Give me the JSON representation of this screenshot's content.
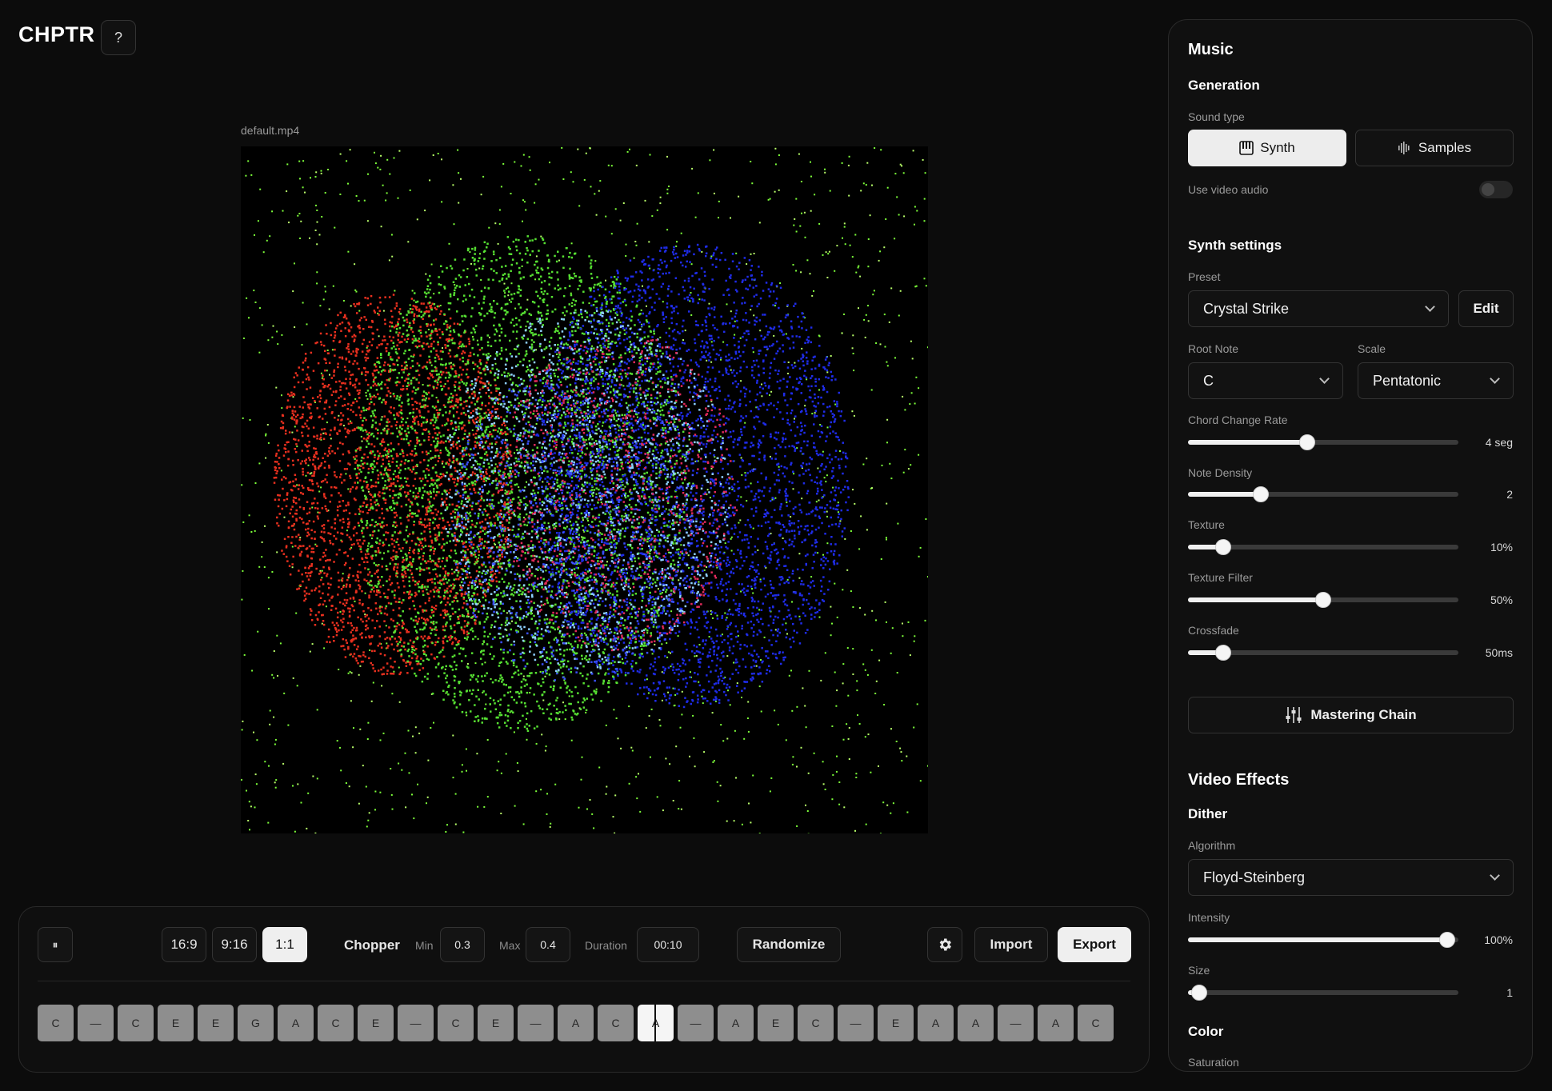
{
  "app": {
    "logo": "CHPTR",
    "help_label": "?"
  },
  "video": {
    "file_name": "default.mp4"
  },
  "transport": {
    "play_pause_label": "⏸",
    "aspect_ratios": [
      {
        "label": "16:9",
        "active": false
      },
      {
        "label": "9:16",
        "active": false
      },
      {
        "label": "1:1",
        "active": true
      }
    ],
    "chopper_label": "Chopper",
    "min_label": "Min",
    "min_value": "0.3",
    "max_label": "Max",
    "max_value": "0.4",
    "duration_label": "Duration",
    "duration_value": "00:10",
    "randomize_label": "Randomize",
    "settings_icon": "gear-icon",
    "import_label": "Import",
    "export_label": "Export",
    "notes": [
      "C",
      "—",
      "C",
      "E",
      "E",
      "G",
      "A",
      "C",
      "E",
      "—",
      "C",
      "E",
      "—",
      "A",
      "C",
      "A",
      "—",
      "A",
      "E",
      "C",
      "—",
      "E",
      "A",
      "A",
      "—",
      "A",
      "C"
    ],
    "active_note_index": 15
  },
  "panel": {
    "music_title": "Music",
    "generation_title": "Generation",
    "sound_type_label": "Sound type",
    "synth_label": "Synth",
    "samples_label": "Samples",
    "use_video_audio_label": "Use video audio",
    "use_video_audio_on": false,
    "synth_settings_title": "Synth settings",
    "preset_label": "Preset",
    "preset_value": "Crystal Strike",
    "edit_label": "Edit",
    "root_note_label": "Root Note",
    "root_note_value": "C",
    "scale_label": "Scale",
    "scale_value": "Pentatonic",
    "sliders": {
      "chord_change_rate": {
        "label": "Chord Change Rate",
        "value_text": "4 seg",
        "fraction": 0.44
      },
      "note_density": {
        "label": "Note Density",
        "value_text": "2",
        "fraction": 0.27
      },
      "texture": {
        "label": "Texture",
        "value_text": "10%",
        "fraction": 0.13
      },
      "texture_filter": {
        "label": "Texture Filter",
        "value_text": "50%",
        "fraction": 0.5
      },
      "crossfade": {
        "label": "Crossfade",
        "value_text": "50ms",
        "fraction": 0.13
      },
      "intensity": {
        "label": "Intensity",
        "value_text": "100%",
        "fraction": 0.96
      },
      "size": {
        "label": "Size",
        "value_text": "1",
        "fraction": 0.04
      }
    },
    "mastering_chain_label": "Mastering Chain",
    "video_effects_title": "Video Effects",
    "dither_title": "Dither",
    "algorithm_label": "Algorithm",
    "algorithm_value": "Floyd-Steinberg",
    "color_title": "Color",
    "saturation_label": "Saturation"
  },
  "colors": {
    "background": "#0c0c0c",
    "panel": "#101010",
    "accent": "#efefef"
  }
}
